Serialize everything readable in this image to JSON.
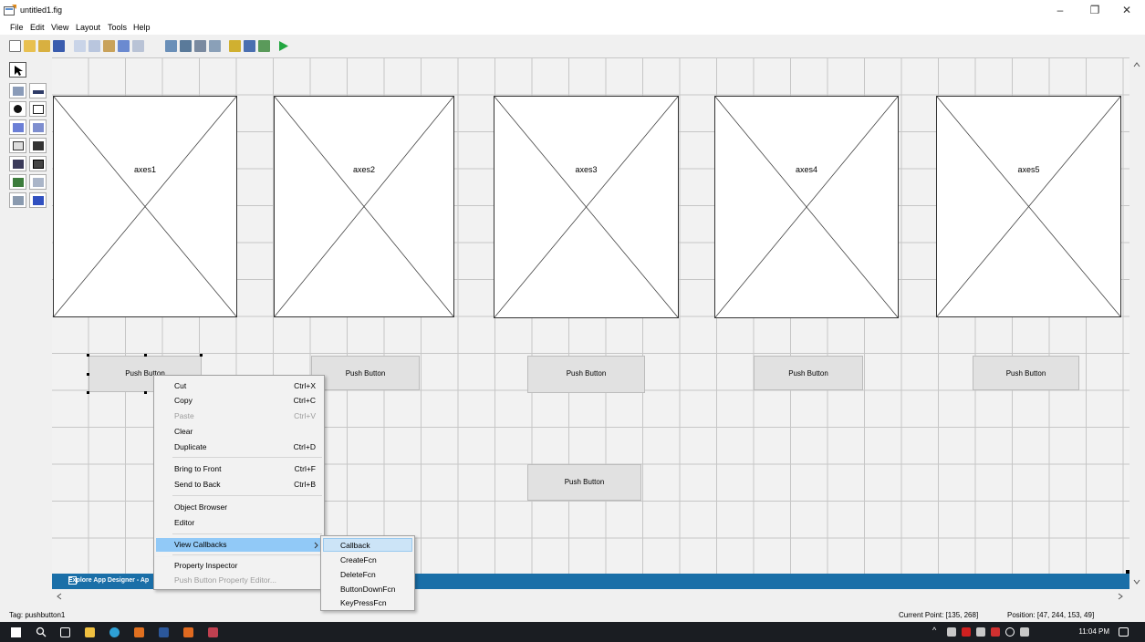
{
  "window": {
    "title": "untitled1.fig",
    "minimize": "–",
    "maximize": "❐",
    "close": "✕"
  },
  "menu": [
    "File",
    "Edit",
    "View",
    "Layout",
    "Tools",
    "Help"
  ],
  "toolbar_icons": [
    "new-icon",
    "open-icon",
    "open-folder-icon",
    "save-icon",
    "cut-icon",
    "copy-icon",
    "paste-icon",
    "undo-icon",
    "redo-icon",
    "align-icon",
    "menu-editor-icon",
    "tab-order-icon",
    "toolbar-editor-icon",
    "editor-icon",
    "property-inspector-icon",
    "object-browser-icon",
    "run-icon"
  ],
  "palette_icons": [
    "select-icon",
    "pushbutton-icon",
    "slider-icon",
    "radiobutton-icon",
    "checkbox-icon",
    "edittext-icon",
    "statictext-icon",
    "popupmenu-icon",
    "listbox-icon",
    "togglebutton-icon",
    "table-icon",
    "axes-icon",
    "panel-icon",
    "buttongroup-icon",
    "activex-icon"
  ],
  "axes": [
    {
      "label": "axes1"
    },
    {
      "label": "axes2"
    },
    {
      "label": "axes3"
    },
    {
      "label": "axes4"
    },
    {
      "label": "axes5"
    }
  ],
  "buttons": [
    {
      "label": "Push Button"
    },
    {
      "label": "Push Button"
    },
    {
      "label": "Push Button"
    },
    {
      "label": "Push Button"
    },
    {
      "label": "Push Button"
    },
    {
      "label": "Push Button"
    }
  ],
  "banner": {
    "text": "Explore App Designer - Ap"
  },
  "context_menu": {
    "items": [
      {
        "label": "Cut",
        "shortcut": "Ctrl+X"
      },
      {
        "label": "Copy",
        "shortcut": "Ctrl+C"
      },
      {
        "label": "Paste",
        "shortcut": "Ctrl+V"
      },
      {
        "label": "Clear",
        "shortcut": ""
      },
      {
        "label": "Duplicate",
        "shortcut": "Ctrl+D"
      },
      {
        "label": "Bring to Front",
        "shortcut": "Ctrl+F"
      },
      {
        "label": "Send to Back",
        "shortcut": "Ctrl+B"
      },
      {
        "label": "Object Browser",
        "shortcut": ""
      },
      {
        "label": "Editor",
        "shortcut": ""
      },
      {
        "label": "View Callbacks",
        "shortcut": ""
      },
      {
        "label": "Property Inspector",
        "shortcut": ""
      },
      {
        "label": "Push Button Property Editor...",
        "shortcut": ""
      }
    ]
  },
  "submenu": {
    "items": [
      "Callback",
      "CreateFcn",
      "DeleteFcn",
      "ButtonDownFcn",
      "KeyPressFcn"
    ]
  },
  "status": {
    "tag": "Tag: pushbutton1",
    "current_point": "Current Point:  [135, 268]",
    "position": "Position: [47, 244, 153, 49]"
  },
  "taskbar": {
    "time": "11:04 PM"
  }
}
